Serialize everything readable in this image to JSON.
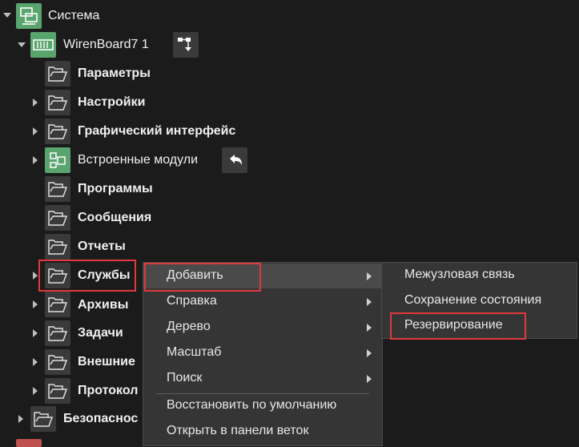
{
  "tree": {
    "root": {
      "label": "Система"
    },
    "device": {
      "label": "WirenBoard7 1"
    },
    "items": [
      {
        "label": "Параметры"
      },
      {
        "label": "Настройки"
      },
      {
        "label": "Графический интерфейс"
      },
      {
        "label": "Встроенные модули"
      },
      {
        "label": "Программы"
      },
      {
        "label": "Сообщения"
      },
      {
        "label": "Отчеты"
      },
      {
        "label": "Службы"
      },
      {
        "label": "Архивы"
      },
      {
        "label": "Задачи"
      },
      {
        "label": "Внешние"
      },
      {
        "label": "Протокол"
      },
      {
        "label": "Безопаснос"
      }
    ]
  },
  "context_menu": {
    "items": [
      {
        "label": "Добавить"
      },
      {
        "label": "Справка"
      },
      {
        "label": "Дерево"
      },
      {
        "label": "Масштаб"
      },
      {
        "label": "Поиск"
      },
      {
        "label": "Восстановить по умолчанию"
      },
      {
        "label": "Открыть в панели веток"
      }
    ]
  },
  "submenu": {
    "items": [
      {
        "label": "Межузловая связь"
      },
      {
        "label": "Сохранение состояния"
      },
      {
        "label": "Резервирование"
      }
    ]
  },
  "colors": {
    "background": "#1b1b1b",
    "menu_bg": "#353535",
    "highlight_box": "#e0393e",
    "node_green": "#5aa46e"
  }
}
